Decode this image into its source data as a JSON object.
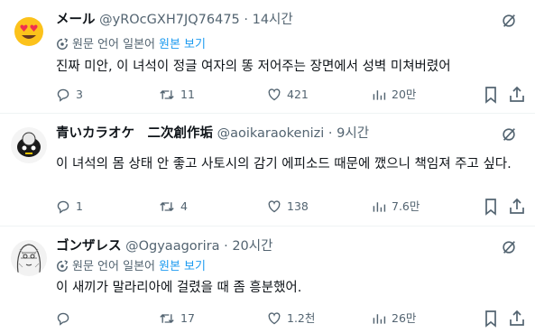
{
  "translation": {
    "lang_label": "원문 언어 일본어",
    "show_label": "원본 보기"
  },
  "tweets": [
    {
      "name": "メール",
      "handle": "@yROcGXH7JQ76475",
      "time": "14시간",
      "text": "진짜 미안, 이 녀석이 정글 여자의 똥 저어주는 장면에서 성벽 미쳐버렸어",
      "replies": "3",
      "retweets": "11",
      "likes": "421",
      "views": "20만"
    },
    {
      "name": "青いカラオケ　二次創作垢",
      "handle": "@aoikaraokenizi",
      "time": "9시간",
      "text": "이 녀석의 몸 상태 안 좋고 사토시의 감기 에피소드 때문에 깼으니 책임져 주고 싶다.",
      "replies": "1",
      "retweets": "4",
      "likes": "138",
      "views": "7.6만"
    },
    {
      "name": "ゴンザレス",
      "handle": "@Ogyaagorira",
      "time": "20시간",
      "text": "이 새끼가 말라리아에 걸렸을 때 좀 흥분했어.",
      "replies": "",
      "retweets": "17",
      "likes": "1.2천",
      "views": "26만"
    }
  ],
  "colors": {
    "accent": "#1d9bf0",
    "muted": "#536471",
    "text": "#0f1419",
    "divider": "#eff3f4",
    "emoji": "#fcc21b",
    "heart_eye": "#f0304f"
  },
  "icons": [
    "grok-icon",
    "translate-icon",
    "reply-icon",
    "retweet-icon",
    "like-icon",
    "views-icon",
    "bookmark-icon",
    "share-icon"
  ]
}
